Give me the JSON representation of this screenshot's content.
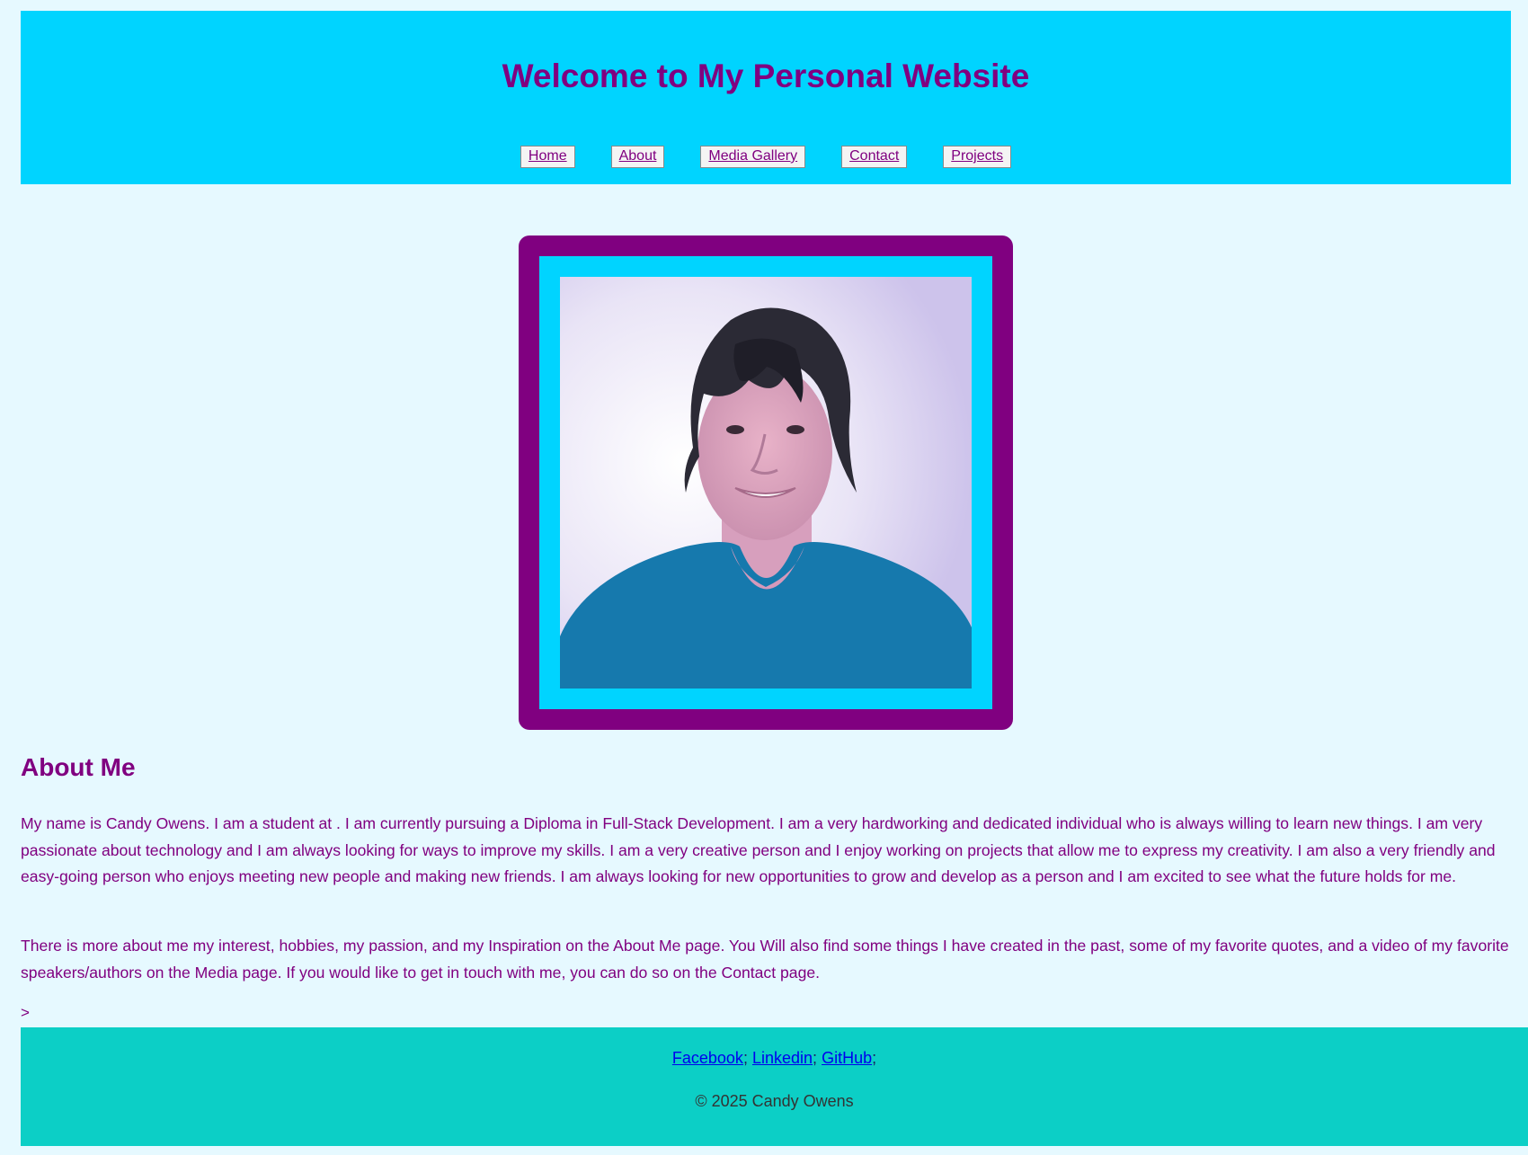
{
  "header": {
    "title": "Welcome to My Personal Website",
    "nav": [
      "Home",
      "About",
      "Media Gallery",
      "Contact",
      "Projects"
    ]
  },
  "about": {
    "heading": "About Me",
    "paragraph1": "My name is Candy Owens. I am a student at . I am currently pursuing a Diploma in Full-Stack Development. I am a very hardworking and dedicated individual who is always willing to learn new things. I am very passionate about technology and I am always looking for ways to improve my skills. I am a very creative person and I enjoy working on projects that allow me to express my creativity. I am also a very friendly and easy-going person who enjoys meeting new people and making new friends. I am always looking for new opportunities to grow and develop as a person and I am excited to see what the future holds for me.",
    "paragraph2": "There is more about me my interest, hobbies, my passion, and my Inspiration on the About Me page. You Will also find some things I have created in the past, some of my favorite quotes, and a video of my favorite speakers/authors on the Media page. If you would like to get in touch with me, you can do so on the Contact page.",
    "stray": ">"
  },
  "footer": {
    "links": [
      "Facebook",
      "Linkedin",
      "GitHub"
    ],
    "separator": ";",
    "copyright": "© 2025 Candy Owens"
  },
  "colors": {
    "background": "#e6f9ff",
    "header": "#00d4ff",
    "accent": "#800080",
    "footer": "#0ccfc6"
  }
}
